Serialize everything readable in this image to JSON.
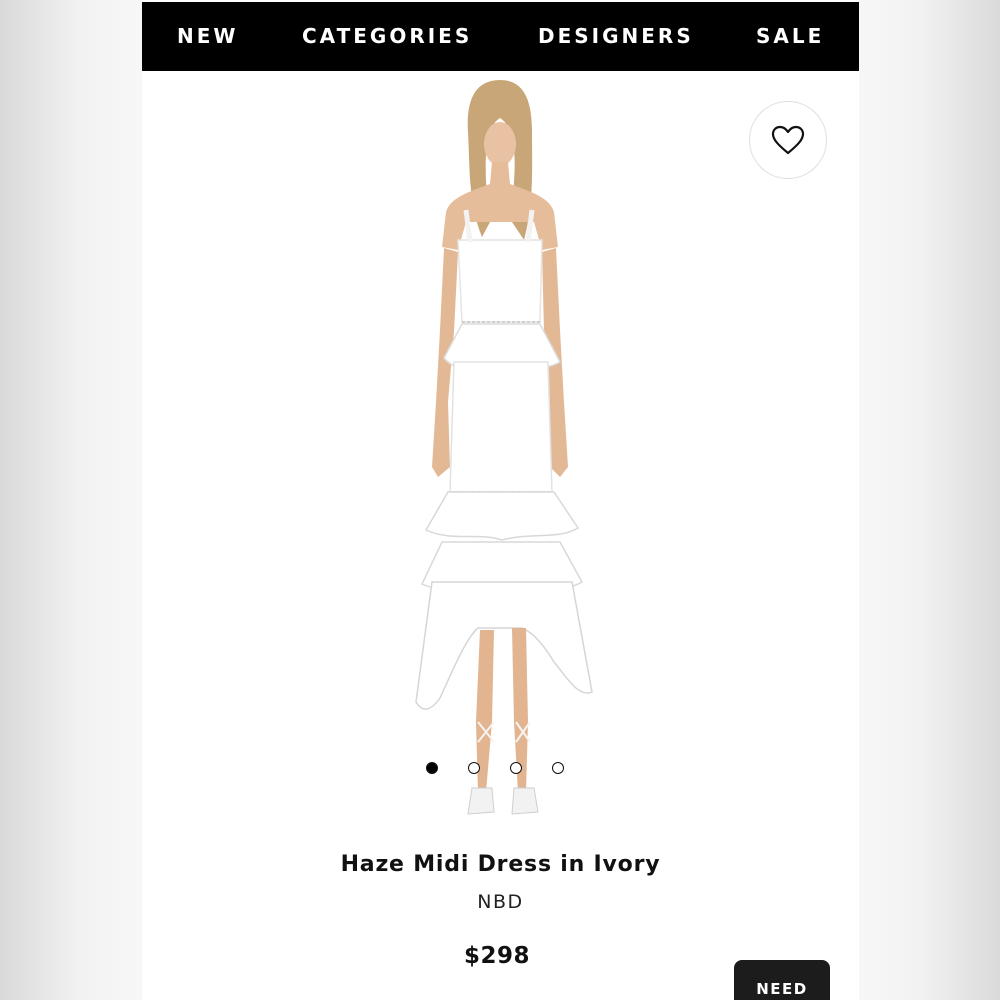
{
  "nav": {
    "items": [
      {
        "label": "NEW"
      },
      {
        "label": "CATEGORIES"
      },
      {
        "label": "DESIGNERS"
      },
      {
        "label": "SALE"
      }
    ]
  },
  "gallery": {
    "image_description_icon": "dress-photo",
    "favorite_icon": "heart-outline-icon",
    "dots": {
      "total": 4,
      "active_index": 0
    }
  },
  "product": {
    "title": "Haze Midi Dress in Ivory",
    "brand": "NBD",
    "price": "$298"
  },
  "help_button": {
    "label": "NEED"
  },
  "colors": {
    "nav_bg": "#000000",
    "nav_text": "#ffffff",
    "help_bg": "#1c1c1c"
  }
}
